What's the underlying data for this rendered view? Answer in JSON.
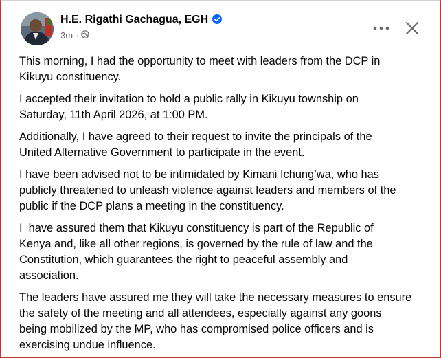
{
  "post": {
    "author": "H.E. Rigathi Gachagua, EGH",
    "time": "3m",
    "separator": "·",
    "paragraphs": [
      "This morning, I had the opportunity to meet with leaders from the DCP in\nKikuyu constituency.",
      "I accepted their invitation to hold a public rally in Kikuyu township on\nSaturday, 11th April 2026, at 1:00 PM.",
      "Additionally, I have agreed to their request to invite the principals of the\nUnited Alternative Government to participate in the event.",
      "I have been advised not to be intimidated by Kimani Ichung’wa, who has\npublicly threatened to unleash violence against leaders and members of the\npublic if the DCP plans a meeting in the constituency.",
      "I  have assured them that Kikuyu constituency is part of the Republic of\nKenya and, like all other regions, is governed by the rule of law and the\nConstitution, which guarantees the right to peaceful assembly and\nassociation.",
      "The leaders have assured me they will take the necessary measures to ensure\nthe safety of the meeting and all attendees, especially against any goons\nbeing mobilized by the MP, who has compromised police officers and is\nexercising undue influence."
    ]
  },
  "icons": {
    "verified": "verified-badge-icon",
    "globe": "globe-icon",
    "more": "more-options-icon",
    "close": "close-icon"
  },
  "colors": {
    "verified_blue": "#0866ff",
    "meta_gray": "#65676b",
    "frame_red": "#c0392b"
  }
}
